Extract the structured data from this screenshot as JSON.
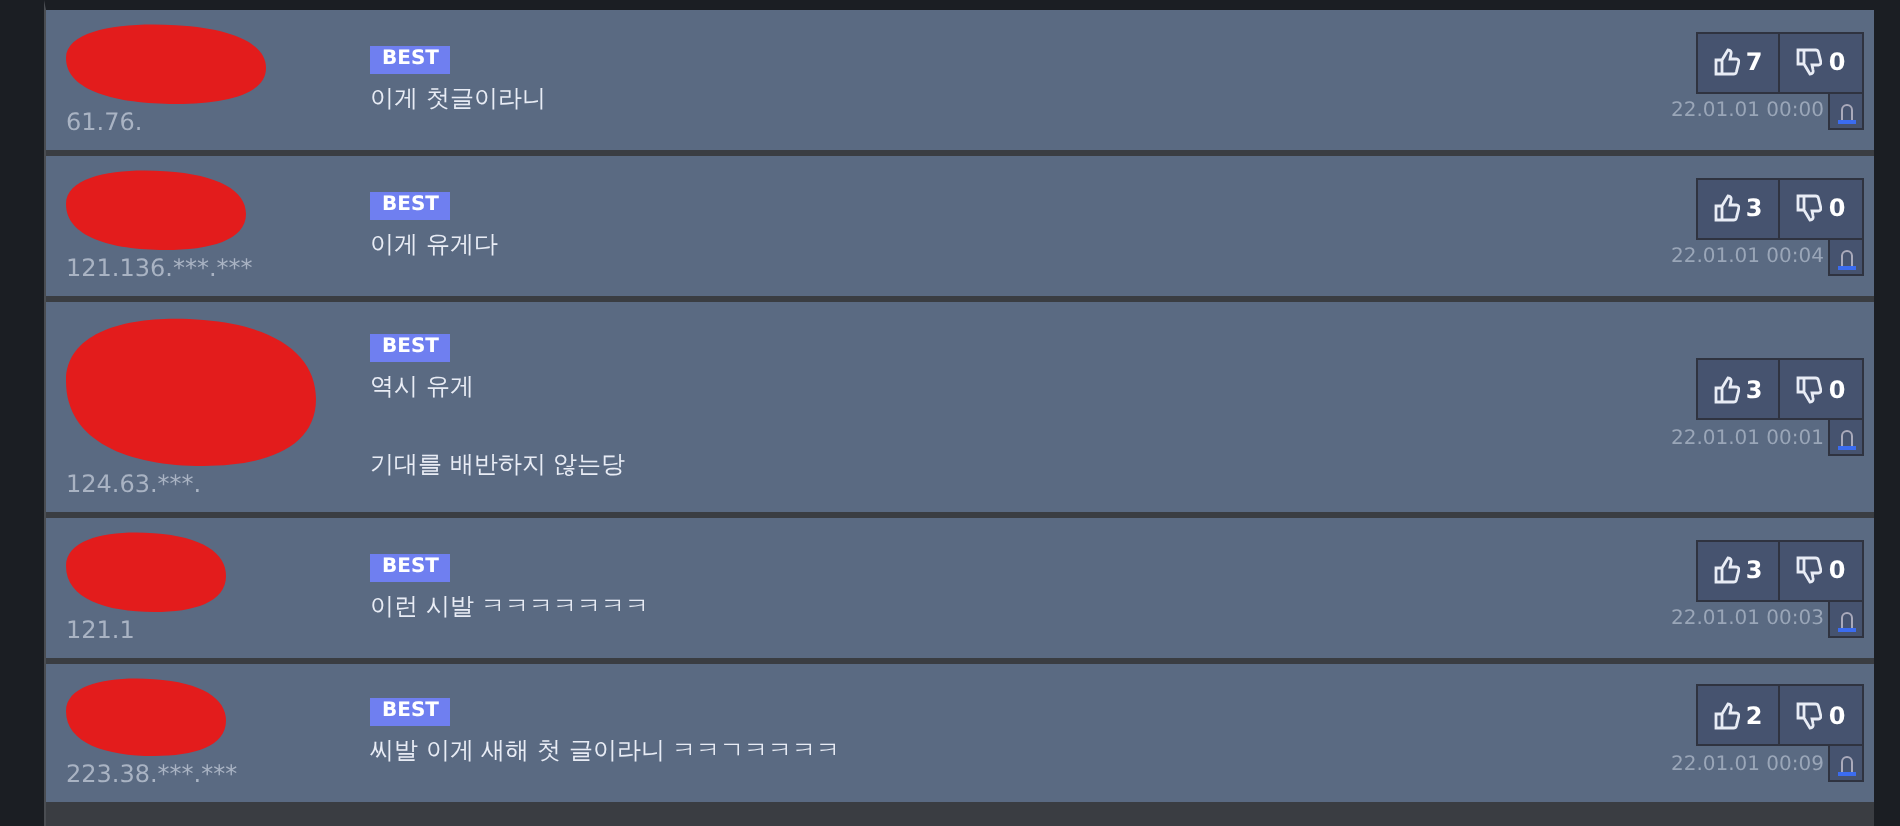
{
  "comments": [
    {
      "ip": "61.76.",
      "badge": "BEST",
      "lines": [
        "이게 첫글이라니"
      ],
      "likes": "7",
      "dislikes": "0",
      "time": "22.01.01 00:00"
    },
    {
      "ip": "121.136.***.***",
      "badge": "BEST",
      "lines": [
        "이게 유게다"
      ],
      "likes": "3",
      "dislikes": "0",
      "time": "22.01.01 00:04"
    },
    {
      "ip": "124.63.***.",
      "badge": "BEST",
      "lines": [
        "역시 유게",
        "기대를 배반하지 않는당"
      ],
      "likes": "3",
      "dislikes": "0",
      "time": "22.01.01 00:01"
    },
    {
      "ip": "121.1",
      "badge": "BEST",
      "lines": [
        "이런 시발 ㅋㅋㅋㅋㅋㅋㅋ"
      ],
      "likes": "3",
      "dislikes": "0",
      "time": "22.01.01 00:03"
    },
    {
      "ip": "223.38.***.***",
      "badge": "BEST",
      "lines": [
        "씨발 이게 새해 첫 글이라니 ㅋㅋㄱㅋㅋㅋㅋ"
      ],
      "likes": "2",
      "dislikes": "0",
      "time": "22.01.01 00:09"
    }
  ]
}
